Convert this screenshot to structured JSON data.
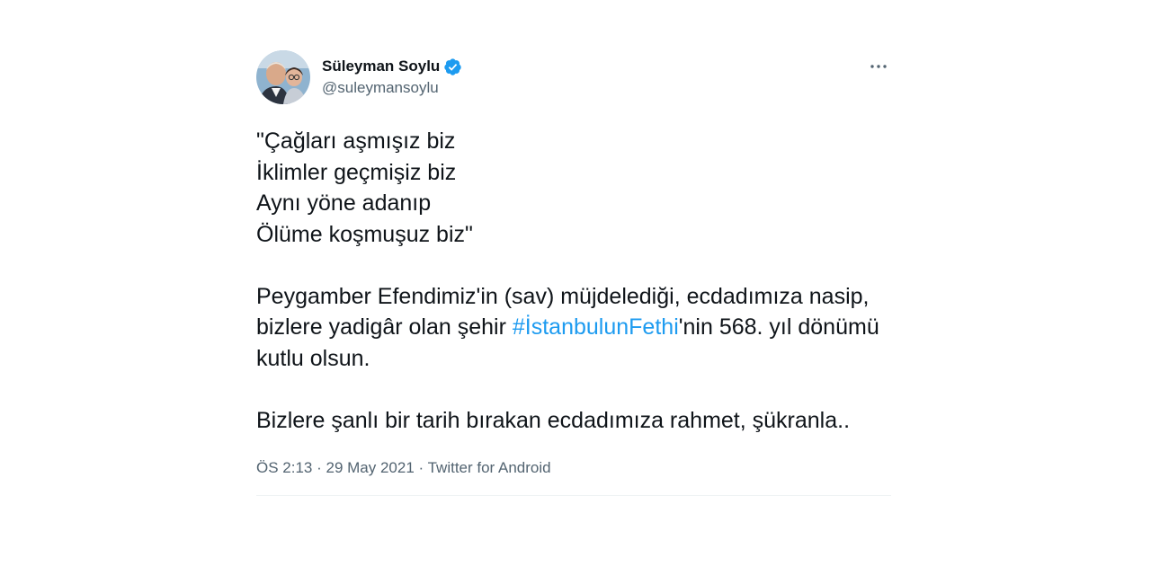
{
  "user": {
    "display_name": "Süleyman Soylu",
    "handle": "@suleymansoylu",
    "verified_icon": "verified-badge-icon",
    "avatar_icon": "profile-photo"
  },
  "more_icon": "more-dots-icon",
  "tweet": {
    "paragraph_1": "\"Çağları aşmışız biz\nİklimler geçmişiz biz\nAynı yöne adanıp\nÖlüme koşmuşuz biz\"",
    "paragraph_2_before": "Peygamber Efendimiz'in (sav) müjdelediği, ecdadımıza nasip, bizlere yadigâr olan şehir ",
    "hashtag": "#İstanbulunFethi",
    "paragraph_2_after": "'nin 568. yıl dönümü kutlu olsun.",
    "paragraph_3": "Bizlere şanlı bir tarih bırakan ecdadımıza rahmet, şükranla.."
  },
  "meta": {
    "time": "ÖS 2:13",
    "separator_1": " · ",
    "date": "29 May 2021",
    "separator_2": " · ",
    "source": "Twitter for Android"
  },
  "colors": {
    "link": "#1d9bf0",
    "verified": "#1d9bf0",
    "text": "#0f1419",
    "secondary": "#536471"
  }
}
